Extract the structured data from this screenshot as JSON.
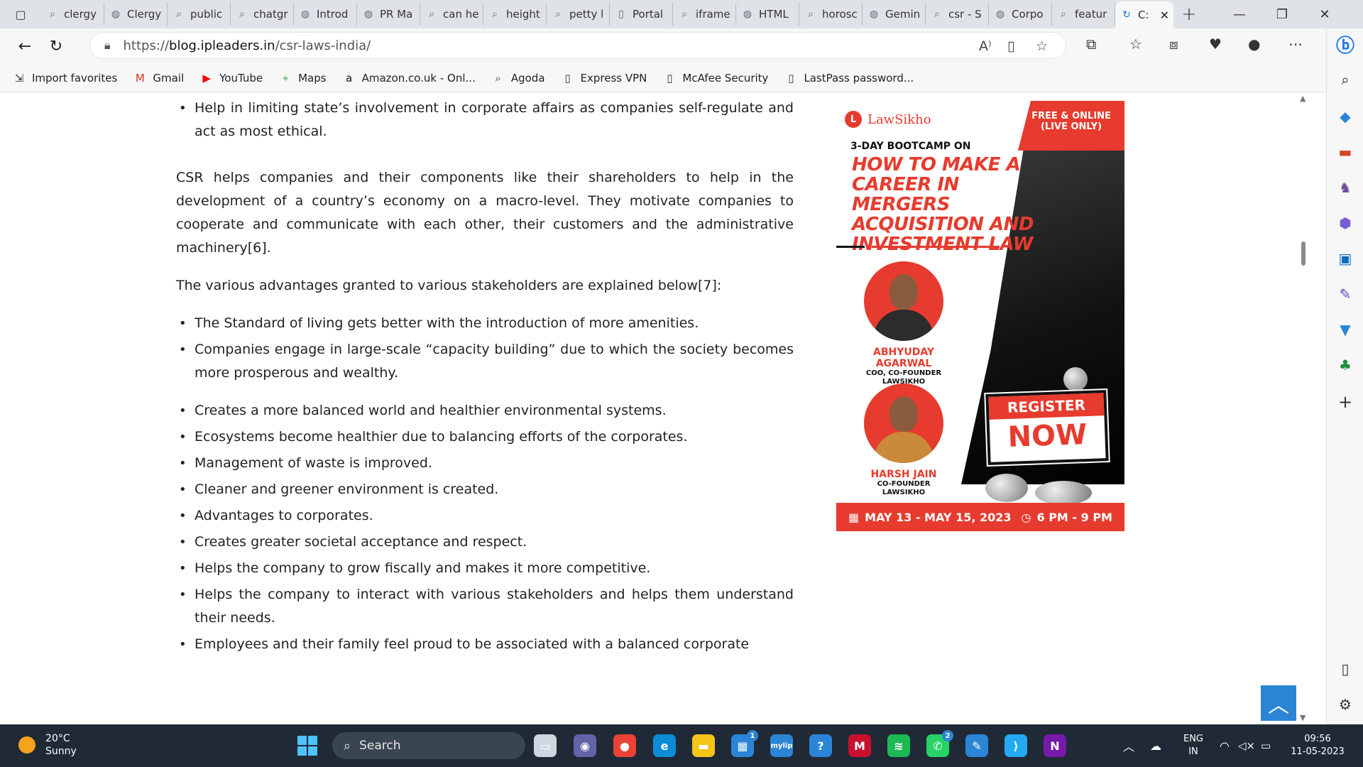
{
  "browser": {
    "tabs": [
      {
        "label": "clergy",
        "icon": "search-icon"
      },
      {
        "label": "Clergy",
        "icon": "site-icon"
      },
      {
        "label": "public",
        "icon": "search-icon"
      },
      {
        "label": "chatgr",
        "icon": "search-icon"
      },
      {
        "label": "Introd",
        "icon": "site-icon"
      },
      {
        "label": "PR Ma",
        "icon": "site-icon"
      },
      {
        "label": "can he",
        "icon": "search-icon"
      },
      {
        "label": "height",
        "icon": "search-icon"
      },
      {
        "label": "petty l",
        "icon": "search-icon"
      },
      {
        "label": "Portal",
        "icon": "page-icon"
      },
      {
        "label": "iframe",
        "icon": "search-icon"
      },
      {
        "label": "HTML",
        "icon": "site-icon"
      },
      {
        "label": "horosc",
        "icon": "search-icon"
      },
      {
        "label": "Gemin",
        "icon": "site-icon"
      },
      {
        "label": "csr - S",
        "icon": "search-icon"
      },
      {
        "label": "Corpo",
        "icon": "site-icon"
      },
      {
        "label": "featur",
        "icon": "search-icon"
      }
    ],
    "active_tab": {
      "label": "C:",
      "icon": "loading-icon"
    },
    "url": {
      "scheme": "https://",
      "host": "blog.ipleaders.in",
      "path": "/csr-laws-india/"
    }
  },
  "favorites": [
    {
      "label": "Import favorites",
      "icon": "import-icon"
    },
    {
      "label": "Gmail",
      "icon": "gmail-icon"
    },
    {
      "label": "YouTube",
      "icon": "youtube-icon"
    },
    {
      "label": "Maps",
      "icon": "maps-icon"
    },
    {
      "label": "Amazon.co.uk - Onl...",
      "icon": "amazon-icon"
    },
    {
      "label": "Agoda",
      "icon": "search-icon"
    },
    {
      "label": "Express VPN",
      "icon": "page-icon"
    },
    {
      "label": "McAfee Security",
      "icon": "page-icon"
    },
    {
      "label": "LastPass password...",
      "icon": "page-icon"
    }
  ],
  "article": {
    "top_bullet": "Help in limiting state’s involvement in corporate affairs as companies self-regulate and act as most ethical.",
    "para1": "CSR helps companies and their components like their shareholders to help in the development of a country’s economy on a macro-level. They motivate companies to cooperate and communicate with each other, their customers and the administrative machinery[6].",
    "para2": "The various advantages granted to various stakeholders are explained below[7]:",
    "list1": [
      "The Standard of living gets better with the introduction of more amenities.",
      "Companies engage in large-scale “capacity building” due to which the society becomes more prosperous and wealthy."
    ],
    "list2": [
      "Creates a more balanced world and healthier environmental systems.",
      "Ecosystems become healthier due to balancing efforts of the corporates.",
      "Management of waste is improved.",
      "Cleaner and greener environment is created.",
      "Advantages to corporates.",
      "Creates greater societal acceptance and respect.",
      "Helps the company to grow fiscally and makes it more competitive.",
      "Helps the company to interact with various stakeholders and helps them understand their needs.",
      "Employees and their family feel proud to be associated with a balanced corporate"
    ]
  },
  "ad": {
    "brand": "LawSikho",
    "ribbon_line1": "FREE & ONLINE",
    "ribbon_line2": "(LIVE ONLY)",
    "bootcamp": "3-DAY BOOTCAMP ON",
    "headline": "HOW TO MAKE A CAREER IN MERGERS ACQUISITION AND INVESTMENT LAW",
    "speaker1_name": "ABHYUDAY AGARWAL",
    "speaker1_role1": "COO, CO-FOUNDER",
    "speaker1_role2": "LAWSIKHO",
    "speaker2_name": "HARSH JAIN",
    "speaker2_role1": "CO-FOUNDER",
    "speaker2_role2": "LAWSIKHO",
    "register": "REGISTER",
    "now": "NOW",
    "dates": "MAY 13 - MAY 15, 2023",
    "time": "6 PM - 9 PM"
  },
  "taskbar": {
    "weather_temp": "20°C",
    "weather_text": "Sunny",
    "search_label": "Search",
    "apps": [
      {
        "name": "task-view",
        "label": "▭",
        "color": "#cfd6de"
      },
      {
        "name": "teams",
        "label": "◉",
        "color": "#6264a7"
      },
      {
        "name": "chrome",
        "label": "●",
        "color": "#ea4335"
      },
      {
        "name": "edge",
        "label": "e",
        "color": "#0c8bd6"
      },
      {
        "name": "file-explorer",
        "label": "▬",
        "color": "#f5c518"
      },
      {
        "name": "store",
        "label": "▦",
        "color": "#2b85d6"
      },
      {
        "name": "mylip",
        "label": "mylip",
        "color": "#2b85d6"
      },
      {
        "name": "help",
        "label": "?",
        "color": "#2b85d6"
      },
      {
        "name": "mcafee",
        "label": "M",
        "color": "#c8102e"
      },
      {
        "name": "spotify",
        "label": "≋",
        "color": "#1db954"
      },
      {
        "name": "whatsapp",
        "label": "✆",
        "color": "#25d366"
      },
      {
        "name": "paint",
        "label": "✎",
        "color": "#2b85d6"
      },
      {
        "name": "vscode",
        "label": "⟩",
        "color": "#23a9f2"
      },
      {
        "name": "onenote",
        "label": "N",
        "color": "#7719aa"
      }
    ],
    "store_badge": "1",
    "whatsapp_badge": "2",
    "lang_line1": "ENG",
    "lang_line2": "IN",
    "time": "09:56",
    "date": "11-05-2023"
  }
}
